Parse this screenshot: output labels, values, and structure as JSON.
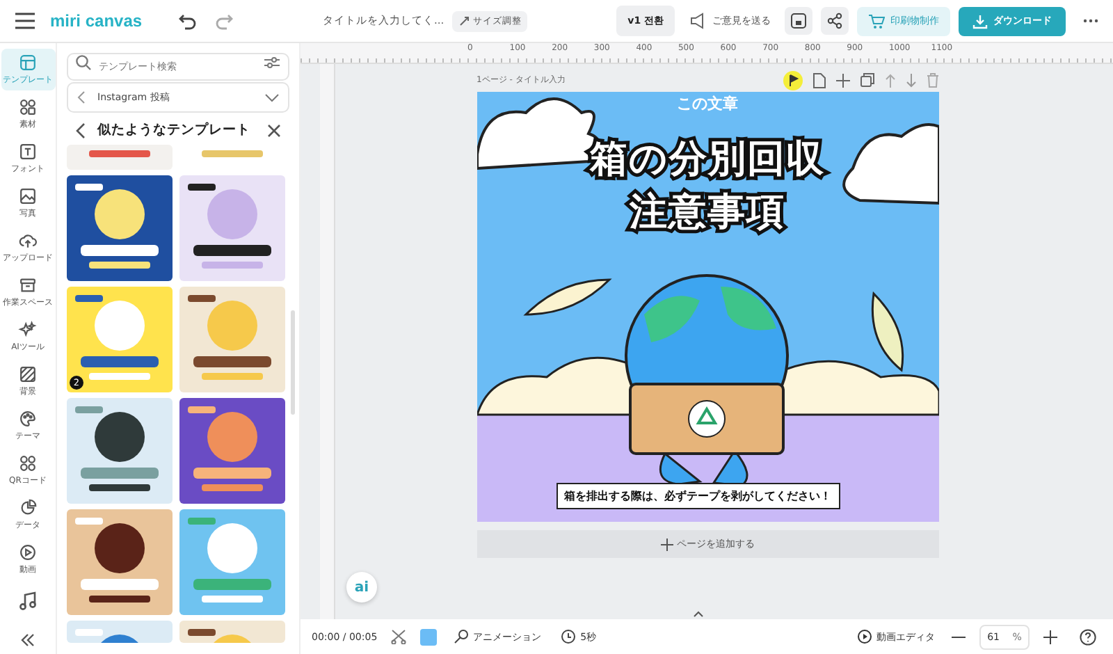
{
  "header": {
    "logo": "miri canvas",
    "title_placeholder": "タイトルを入力してく...",
    "resize_label": "サイズ調整",
    "version_button": "v1 전환",
    "feedback_button": "ご意見を送る",
    "print_button": "印刷物制作",
    "download_button": "ダウンロード"
  },
  "rail": [
    {
      "label": "テンプレート",
      "selected": true
    },
    {
      "label": "素材",
      "selected": false
    },
    {
      "label": "フォント",
      "selected": false
    },
    {
      "label": "写真",
      "selected": false
    },
    {
      "label": "アップロード",
      "selected": false
    },
    {
      "label": "作業スペース",
      "selected": false
    },
    {
      "label": "AIツール",
      "selected": false
    },
    {
      "label": "背景",
      "selected": false
    },
    {
      "label": "テーマ",
      "selected": false
    },
    {
      "label": "QRコード",
      "selected": false
    },
    {
      "label": "データ",
      "selected": false
    },
    {
      "label": "動画",
      "selected": false
    }
  ],
  "panel": {
    "search_placeholder": "テンプレート検索",
    "category": "Instagram 投稿",
    "heading": "似たようなテンプレート",
    "templates": [
      {
        "kind": "picture"
      },
      {
        "kind": "picture"
      },
      {
        "kind": "picture"
      },
      {
        "kind": "picture"
      },
      {
        "kind": "picture",
        "badge": "2"
      },
      {
        "kind": "picture"
      },
      {
        "kind": "picture"
      },
      {
        "kind": "picture"
      },
      {
        "kind": "picture"
      },
      {
        "kind": "picture"
      },
      {
        "kind": "picture"
      },
      {
        "kind": "picture"
      }
    ]
  },
  "editor": {
    "ruler_marks": [
      "0",
      "100",
      "200",
      "300",
      "400",
      "500",
      "600",
      "700",
      "800",
      "900",
      "1000",
      "1100"
    ],
    "page_label": "1ページ - タイトル入力",
    "page": {
      "subtitle": "この文章",
      "title_lines": [
        "箱の分別回収",
        "注意事項"
      ],
      "notice": "箱を排出する際は、必ずテープを剥がしてください！"
    },
    "add_page": "ページを追加する",
    "ai_badge": "ai"
  },
  "bottom_bar": {
    "time_current": "00:00",
    "time_separator": "/",
    "time_total": "00:05",
    "animation": "アニメーション",
    "duration": "5秒",
    "video_editor": "動画エディタ",
    "zoom": "61",
    "zoom_unit": "%"
  }
}
